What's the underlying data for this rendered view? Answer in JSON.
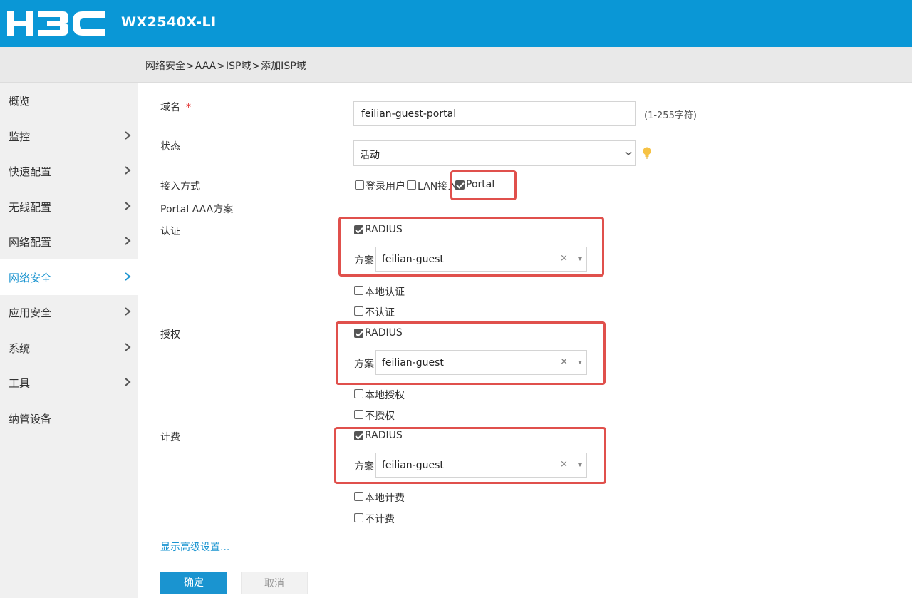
{
  "header": {
    "logo_text": "H3C",
    "model": "WX2540X-LI"
  },
  "breadcrumb": [
    "网络安全",
    "AAA",
    "ISP域",
    "添加ISP域"
  ],
  "breadcrumb_sep": ">",
  "sidebar": {
    "items": [
      {
        "label": "概览",
        "has_chevron": false
      },
      {
        "label": "监控",
        "has_chevron": true
      },
      {
        "label": "快速配置",
        "has_chevron": true
      },
      {
        "label": "无线配置",
        "has_chevron": true
      },
      {
        "label": "网络配置",
        "has_chevron": true
      },
      {
        "label": "网络安全",
        "has_chevron": true,
        "active": true
      },
      {
        "label": "应用安全",
        "has_chevron": true
      },
      {
        "label": "系统",
        "has_chevron": true
      },
      {
        "label": "工具",
        "has_chevron": true
      },
      {
        "label": "纳管设备",
        "has_chevron": false
      }
    ]
  },
  "form": {
    "domain_label": "域名",
    "required_mark": "*",
    "domain_value": "feilian-guest-portal",
    "domain_hint": "(1-255字符)",
    "status_label": "状态",
    "status_value": "活动",
    "access_label": "接入方式",
    "access_options": [
      {
        "label": "登录用户",
        "checked": false
      },
      {
        "label": "LAN接入",
        "checked": false
      },
      {
        "label": "Portal",
        "checked": true
      }
    ],
    "portal_aaa_label": "Portal AAA方案",
    "auth": {
      "label": "认证",
      "radius_label": "RADIUS",
      "radius_checked": true,
      "scheme_label": "方案",
      "scheme_value": "feilian-guest",
      "local_label": "本地认证",
      "local_checked": false,
      "none_label": "不认证",
      "none_checked": false
    },
    "authz": {
      "label": "授权",
      "radius_label": "RADIUS",
      "radius_checked": true,
      "scheme_label": "方案",
      "scheme_value": "feilian-guest",
      "local_label": "本地授权",
      "local_checked": false,
      "none_label": "不授权",
      "none_checked": false
    },
    "acct": {
      "label": "计费",
      "radius_label": "RADIUS",
      "radius_checked": true,
      "scheme_label": "方案",
      "scheme_value": "feilian-guest",
      "local_label": "本地计费",
      "local_checked": false,
      "none_label": "不计费",
      "none_checked": false
    },
    "clear_symbol": "×",
    "advanced_link": "显示高级设置...",
    "ok_button": "确定",
    "cancel_button": "取消"
  },
  "colors": {
    "header_bg": "#0a97d6",
    "accent": "#1a94d0",
    "highlight_box": "#e0504c"
  }
}
